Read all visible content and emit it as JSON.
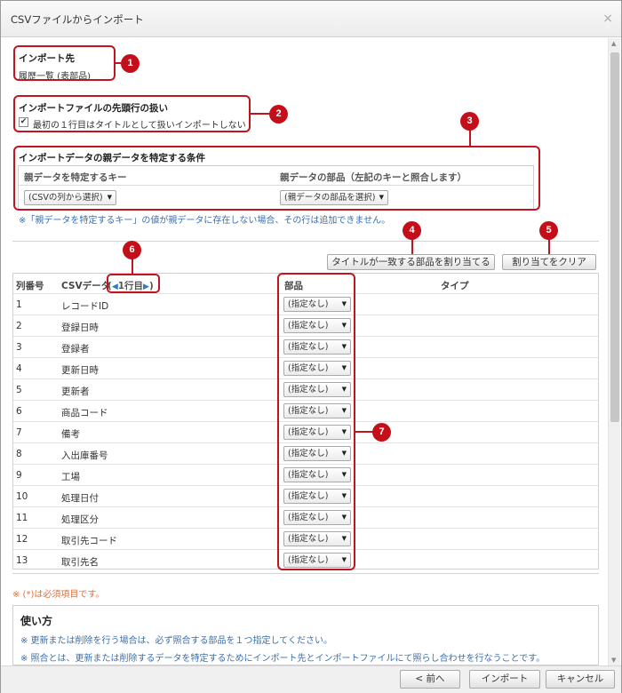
{
  "dialog": {
    "title": "CSVファイルからインポート",
    "close": "×"
  },
  "section1": {
    "label": "インポート先",
    "value": "履歴一覧 (表部品)"
  },
  "section2": {
    "label": "インポートファイルの先頭行の扱い",
    "checkbox_label": "最初の１行目はタイトルとして扱いインポートしない",
    "checked": true
  },
  "section3": {
    "label": "インポートデータの親データを特定する条件",
    "col1_header": "親データを特定するキー",
    "col2_header": "親データの部品（左記のキーと照合します）",
    "select1": "(CSVの列から選択)",
    "select2": "(親データの部品を選択)",
    "note": "※「親データを特定するキー」の値が親データに存在しない場合、その行は追加できません。"
  },
  "buttons": {
    "assign_matching": "タイトルが一致する部品を割り当てる",
    "clear_assign": "割り当てをクリア"
  },
  "mapping_table": {
    "headers": {
      "col_no": "列番号",
      "csv_data": "CSVデータ",
      "row_nav_prefix": "(",
      "row_nav": "1行目",
      "row_nav_suffix": ")",
      "part": "部品",
      "type": "タイプ"
    },
    "rows": [
      {
        "no": "1",
        "csv": "レコードID",
        "part": "(指定なし)"
      },
      {
        "no": "2",
        "csv": "登録日時",
        "part": "(指定なし)"
      },
      {
        "no": "3",
        "csv": "登録者",
        "part": "(指定なし)"
      },
      {
        "no": "4",
        "csv": "更新日時",
        "part": "(指定なし)"
      },
      {
        "no": "5",
        "csv": "更新者",
        "part": "(指定なし)"
      },
      {
        "no": "6",
        "csv": "商品コード",
        "part": "(指定なし)"
      },
      {
        "no": "7",
        "csv": "備考",
        "part": "(指定なし)"
      },
      {
        "no": "8",
        "csv": "入出庫番号",
        "part": "(指定なし)"
      },
      {
        "no": "9",
        "csv": "工場",
        "part": "(指定なし)"
      },
      {
        "no": "10",
        "csv": "処理日付",
        "part": "(指定なし)"
      },
      {
        "no": "11",
        "csv": "処理区分",
        "part": "(指定なし)"
      },
      {
        "no": "12",
        "csv": "取引先コード",
        "part": "(指定なし)"
      },
      {
        "no": "13",
        "csv": "取引先名",
        "part": "(指定なし)"
      }
    ]
  },
  "required_note": "※ (*)は必須項目です。",
  "howto": {
    "title": "使い方",
    "line1": "※ 更新または削除を行う場合は、必ず照合する部品を１つ指定してください。",
    "line2": "※ 照合とは、更新または削除するデータを特定するためにインポート先とインポートファイルにて照らし合わせを行なうことです。"
  },
  "footer": {
    "back": "< 前へ",
    "import": "インポート",
    "cancel": "キャンセル"
  },
  "callouts": [
    "1",
    "2",
    "3",
    "4",
    "5",
    "6",
    "7"
  ],
  "colors": {
    "callout_red": "#c40f1b",
    "note_orange": "#e0703a",
    "note_blue": "#3a6fb0",
    "nav_blue": "#2e7ec2"
  }
}
